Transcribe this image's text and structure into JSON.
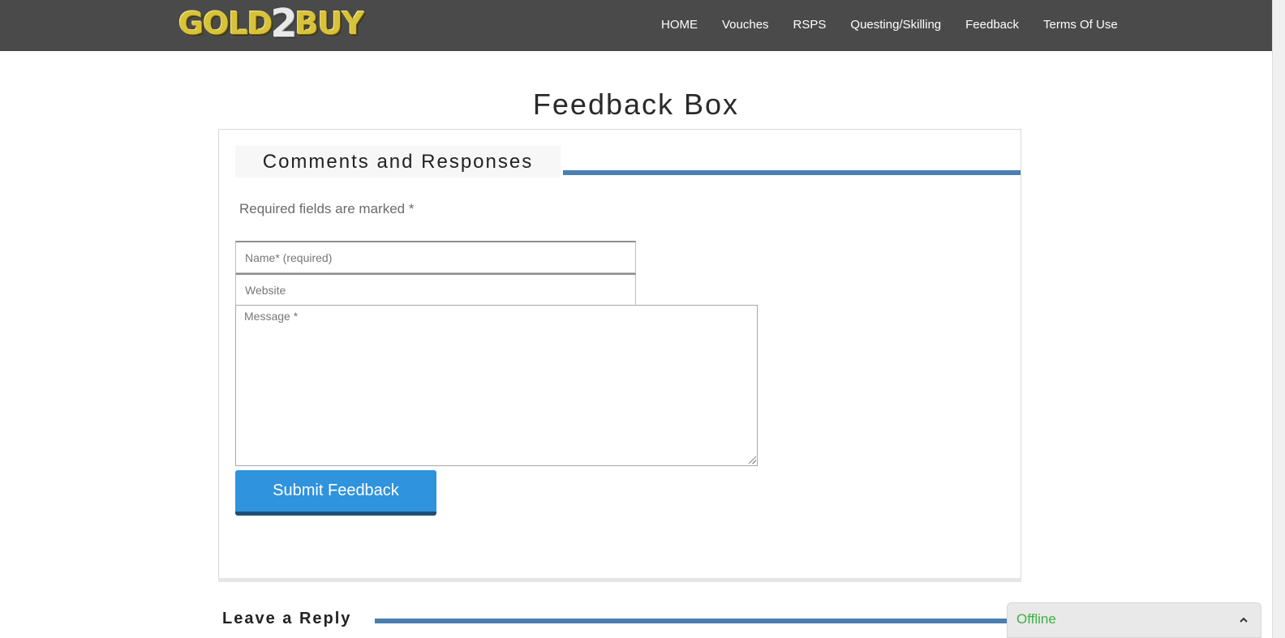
{
  "header": {
    "logo": {
      "part1": "GOLD",
      "part2": "2",
      "part3": "BUY"
    },
    "nav": [
      {
        "label": "HOME"
      },
      {
        "label": "Vouches"
      },
      {
        "label": "RSPS"
      },
      {
        "label": "Questing/Skilling"
      },
      {
        "label": "Feedback"
      },
      {
        "label": "Terms Of Use"
      }
    ]
  },
  "page": {
    "title": "Feedback Box"
  },
  "comments": {
    "heading": "Comments and Responses",
    "required_note": "Required fields are marked *",
    "form": {
      "name_placeholder": "Name* (required)",
      "name_value": "",
      "website_placeholder": "Website",
      "website_value": "",
      "message_placeholder": "Message *",
      "message_value": "",
      "submit_label": "Submit Feedback"
    }
  },
  "reply": {
    "heading": "Leave a Reply"
  },
  "chat": {
    "status": "Offline",
    "status_color": "#3cb043",
    "toggle_icon": "chevron-up-icon"
  },
  "colors": {
    "accent": "#4a7fb0",
    "button": "#2f93dd",
    "header_bg": "#4a4a4a"
  }
}
